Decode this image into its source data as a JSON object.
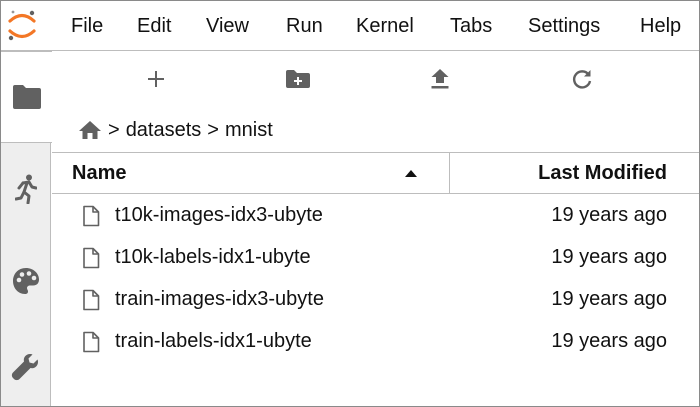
{
  "menubar": {
    "items": [
      {
        "id": "file",
        "label": "File"
      },
      {
        "id": "edit",
        "label": "Edit"
      },
      {
        "id": "view",
        "label": "View"
      },
      {
        "id": "run",
        "label": "Run"
      },
      {
        "id": "kernel",
        "label": "Kernel"
      },
      {
        "id": "tabs",
        "label": "Tabs"
      },
      {
        "id": "settings",
        "label": "Settings"
      },
      {
        "id": "help",
        "label": "Help"
      }
    ],
    "logo_icon": "jupyter-logo-icon",
    "accent_color": "#f37726"
  },
  "sidebar": {
    "tabs": [
      {
        "id": "file-browser",
        "icon": "folder-icon",
        "active": true
      },
      {
        "id": "running",
        "icon": "running-icon",
        "active": false
      },
      {
        "id": "commands",
        "icon": "palette-icon",
        "active": false
      },
      {
        "id": "tools",
        "icon": "wrench-icon",
        "active": false
      }
    ]
  },
  "filebrowser": {
    "toolbar": [
      {
        "id": "new-launcher",
        "icon": "plus-icon"
      },
      {
        "id": "new-folder",
        "icon": "new-folder-icon"
      },
      {
        "id": "upload",
        "icon": "upload-icon"
      },
      {
        "id": "refresh",
        "icon": "refresh-icon"
      }
    ],
    "breadcrumbs": {
      "home_icon": "home-icon",
      "separator": ">",
      "parts": [
        "datasets",
        "mnist"
      ]
    },
    "header": {
      "name": "Name",
      "modified": "Last Modified",
      "sort_direction": "ascending"
    },
    "files": [
      {
        "name": "t10k-images-idx3-ubyte",
        "modified": "19 years ago",
        "icon": "file-icon"
      },
      {
        "name": "t10k-labels-idx1-ubyte",
        "modified": "19 years ago",
        "icon": "file-icon"
      },
      {
        "name": "train-images-idx3-ubyte",
        "modified": "19 years ago",
        "icon": "file-icon"
      },
      {
        "name": "train-labels-idx1-ubyte",
        "modified": "19 years ago",
        "icon": "file-icon"
      }
    ]
  }
}
